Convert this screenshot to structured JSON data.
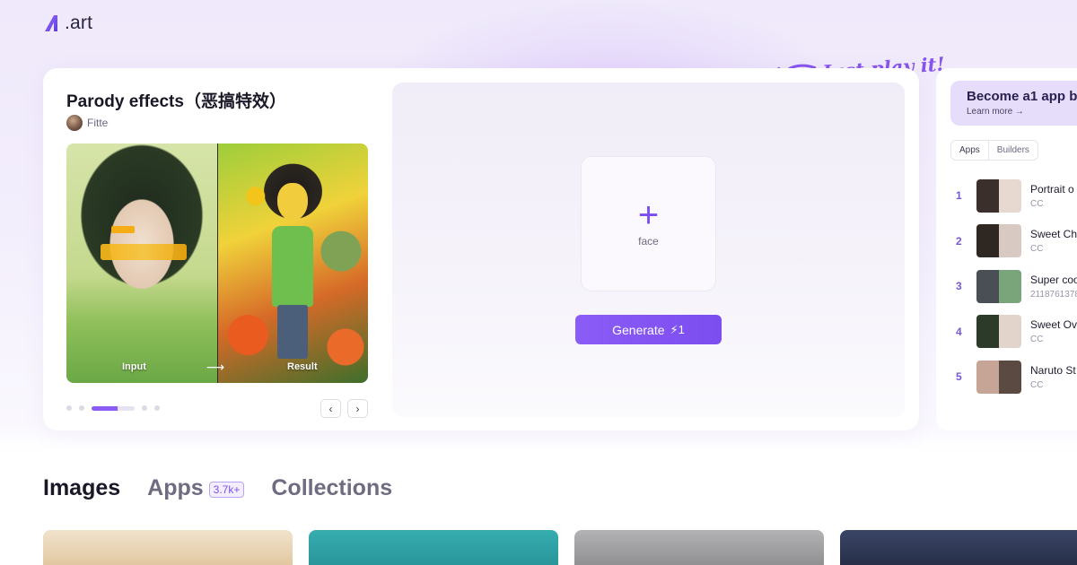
{
  "logo": {
    "text": ".art"
  },
  "app": {
    "title": "Parody effects（恶搞特效）",
    "author": "Fitte",
    "preview": {
      "input_label": "Input",
      "arrow": "⟶",
      "result_label": "Result"
    },
    "carousel": {
      "dot_count": 6,
      "active_index": 2,
      "prev": "‹",
      "next": "›"
    },
    "upload": {
      "icon": "plus-icon",
      "plus": "+",
      "label": "face"
    },
    "generate": {
      "label": "Generate",
      "cost": "⚡1"
    },
    "note": "Just play it!"
  },
  "right_panel": {
    "banner_title": "Become a1 app b",
    "banner_sub": "Learn more →",
    "tabs": [
      "Apps",
      "Builders"
    ],
    "ranking": [
      {
        "rank": "1",
        "title": "Portrait o",
        "sub": "CC",
        "colors": [
          "#3a2f2a",
          "#e8d9d0"
        ]
      },
      {
        "rank": "2",
        "title": "Sweet Ch",
        "sub": "CC",
        "colors": [
          "#2f2722",
          "#d8c9c2"
        ]
      },
      {
        "rank": "3",
        "title": "Super coo",
        "sub": "2118761378",
        "colors": [
          "#4a4e55",
          "#7aa57a"
        ]
      },
      {
        "rank": "4",
        "title": "Sweet Ov",
        "sub": "CC",
        "colors": [
          "#2c3a2a",
          "#e2d4cb"
        ]
      },
      {
        "rank": "5",
        "title": "Naruto St",
        "sub": "CC",
        "colors": [
          "#c7a596",
          "#5b4a42"
        ]
      }
    ]
  },
  "sections": {
    "tabs": [
      {
        "label": "Images",
        "active": true
      },
      {
        "label": "Apps",
        "badge": "3.7k+"
      },
      {
        "label": "Collections"
      }
    ]
  },
  "thumbnails": [
    {
      "color": "#e9d6b8"
    },
    {
      "color": "#2ea4a8"
    },
    {
      "color": "#9a9a9c"
    },
    {
      "color": "#2c3550"
    }
  ],
  "colors": {
    "accent": "#8b5cf6",
    "rank_number": "#7558d8",
    "note": "#8654ee"
  }
}
